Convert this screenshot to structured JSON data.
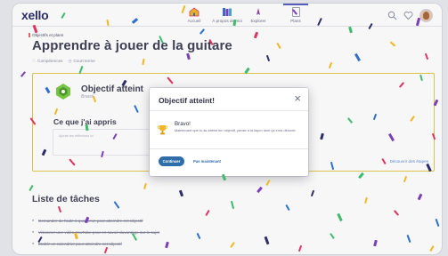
{
  "header": {
    "logo": "xello",
    "nav": [
      {
        "label": "Accueil",
        "icon": "home-icon"
      },
      {
        "label": "À propos de moi",
        "icon": "books-icon"
      },
      {
        "label": "Explorer",
        "icon": "compass-icon"
      },
      {
        "label": "Plans",
        "icon": "clipboard-icon"
      }
    ],
    "right_icons": [
      "search-icon",
      "heart-icon",
      "avatar"
    ]
  },
  "page": {
    "breadcrumb": "Objectifs et plans",
    "title": "Apprendre à jouer de la guitare",
    "meta": [
      "Compétences",
      "Court terme"
    ]
  },
  "goal_card": {
    "title": "Objectif atteint",
    "subtitle": "Bravo!",
    "learned_heading": "Ce que j'ai appris",
    "reflection_placeholder": "Ajoute tes réflexions ici",
    "discover_link": "Découvrir des étapes"
  },
  "tasks": {
    "heading": "Liste de tâches",
    "items": [
      "Demander de l'aide à quelqu'un pour atteindre cet objectif",
      "Visionner une vidéo YouTube pour en savoir davantage sur le sujet",
      "Établir un calendrier pour atteindre cet objectif"
    ]
  },
  "modal": {
    "title": "Objectif atteint!",
    "close_glyph": "×",
    "bravo": "Bravo!",
    "description": "Maintenant que tu as atteint ton objectif, pense à la façon dont ça s'est déroulé.",
    "continue_label": "Continuer",
    "later_label": "Pas maintenant"
  },
  "colors": {
    "accent": "#2e6da8",
    "brand": "#2c2d6b",
    "card_border": "#e4c84a",
    "confetti": [
      "#e0345c",
      "#2d6fd2",
      "#3dbb6a",
      "#f2b624",
      "#7b3fb8",
      "#2c2d6b"
    ]
  }
}
